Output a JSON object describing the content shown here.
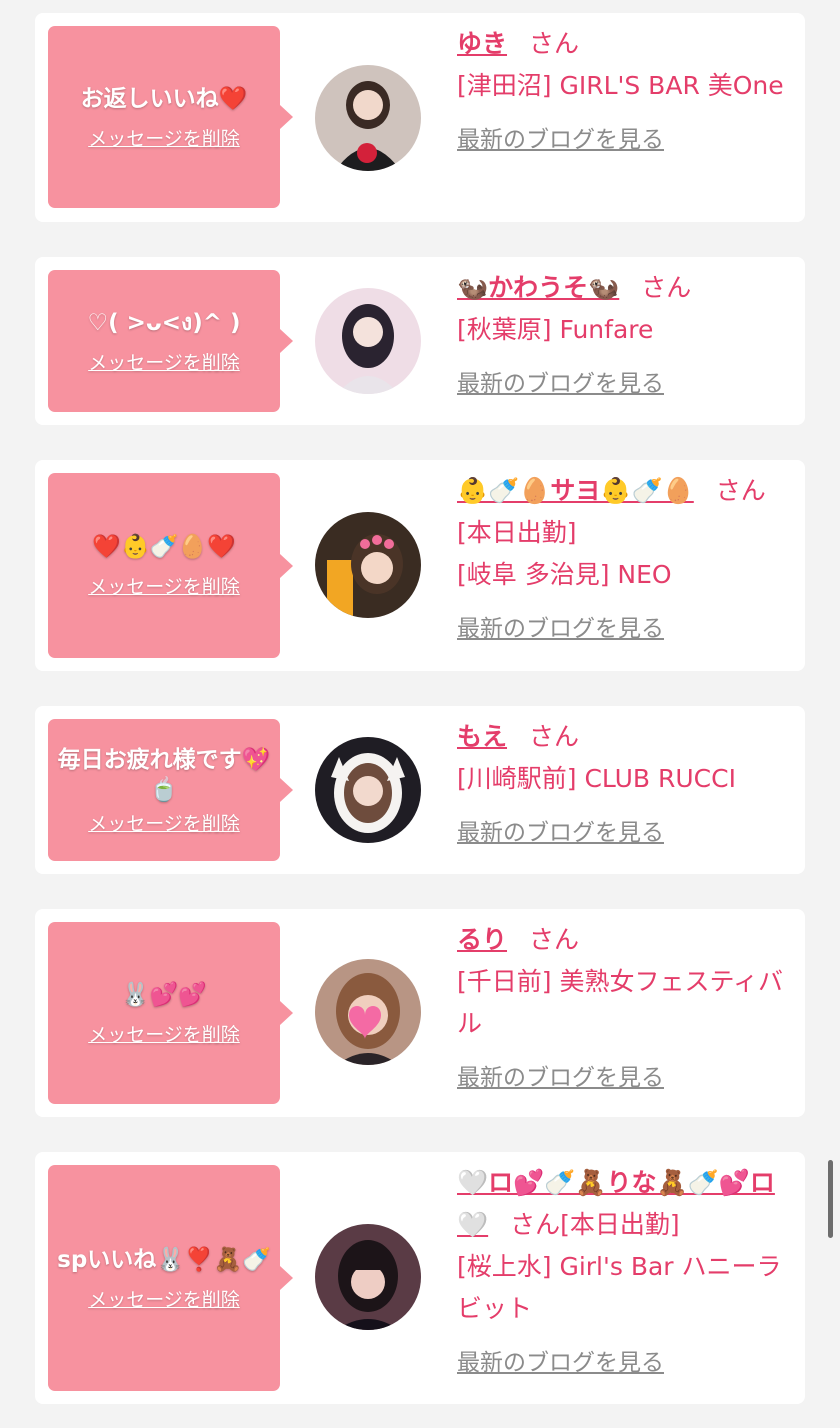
{
  "colors": {
    "bubble": "#f7929f",
    "accent": "#e43d6a",
    "link_gray": "#8b8b8b",
    "background": "#f3f3f3"
  },
  "delete_label": "メッセージを削除",
  "san_label": "さん",
  "blog_label": "最新のブログを見る",
  "entries": [
    {
      "message": "お返しいいね❤️",
      "name": "ゆき",
      "shop": "[津田沼] GIRL'S BAR 美One",
      "status": ""
    },
    {
      "message": "♡( >ᴗ<ง)^ )",
      "name": "🦦かわうそ🦦",
      "shop": "[秋葉原] Funfare",
      "status": ""
    },
    {
      "message": "❤️👶🍼🥚❤️",
      "name": "👶🍼🥚サヨ👶🍼🥚",
      "shop": "[岐阜 多治見] NEO",
      "status": "[本日出勤]"
    },
    {
      "message": "毎日お疲れ様です💖🍵",
      "name": "もえ",
      "shop": "[川崎駅前] CLUB RUCCI",
      "status": ""
    },
    {
      "message": "🐰💕💕",
      "name": "るり",
      "shop": "[千日前] 美熟女フェスティバル",
      "status": ""
    },
    {
      "message": "spいいね🐰❣️🧸🍼",
      "name": "🤍ロ💕🍼🧸りな🧸🍼💕ロ🤍",
      "shop": "[桜上水] Girl's Bar ハニーラビット",
      "status": "[本日出勤]"
    }
  ]
}
